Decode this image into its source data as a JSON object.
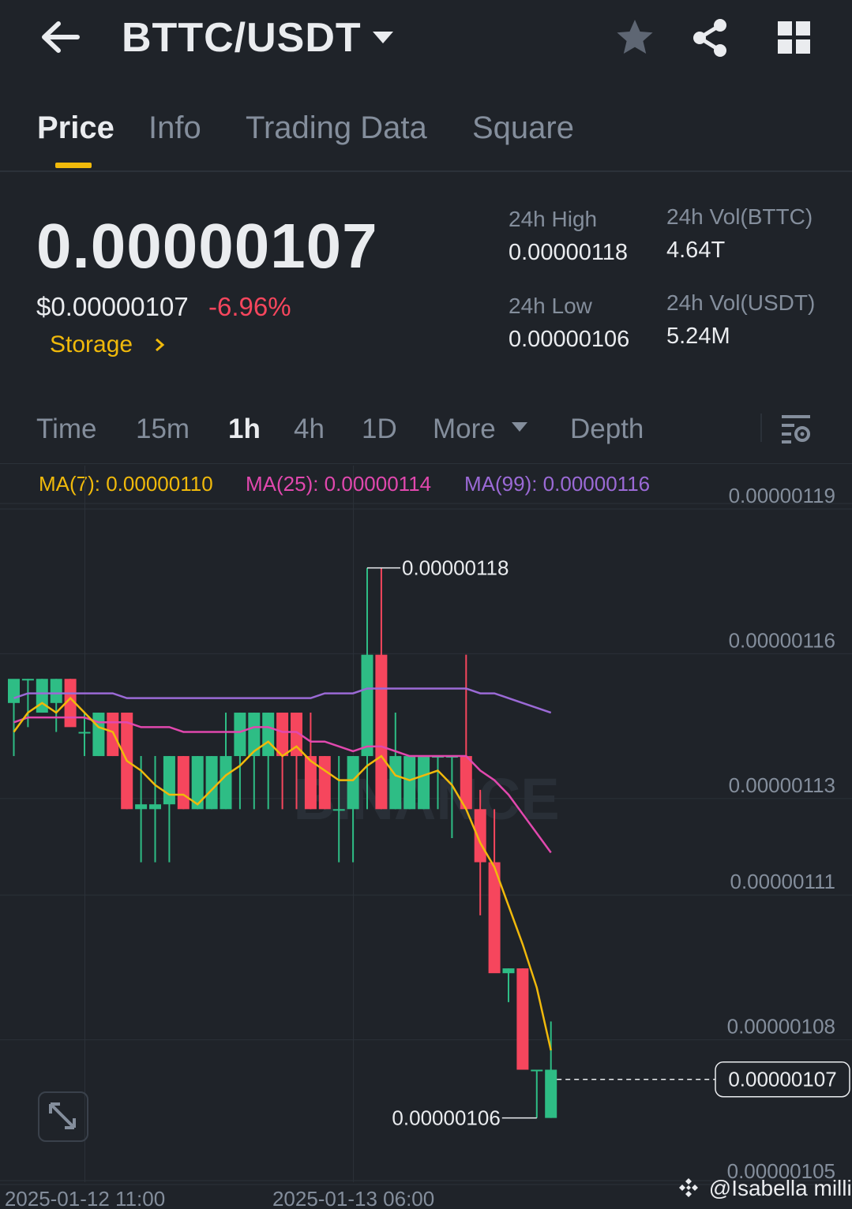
{
  "header": {
    "pair": "BTTC/USDT",
    "back_icon": "arrow-left-icon",
    "icons": [
      "star-icon",
      "share-icon",
      "grid-icon"
    ]
  },
  "tabs": [
    {
      "label": "Price",
      "active": true
    },
    {
      "label": "Info",
      "active": false
    },
    {
      "label": "Trading Data",
      "active": false
    },
    {
      "label": "Square",
      "active": false
    }
  ],
  "ticker": {
    "last_price": "0.00000107",
    "usd_price": "$0.00000107",
    "change": "-6.96%",
    "tag": "Storage",
    "stats": [
      {
        "label": "24h High",
        "value": "0.00000118"
      },
      {
        "label": "24h Vol(BTTC)",
        "value": "4.64T"
      },
      {
        "label": "24h Low",
        "value": "0.00000106"
      },
      {
        "label": "24h Vol(USDT)",
        "value": "5.24M"
      }
    ]
  },
  "intervals": [
    {
      "label": "Time",
      "active": false
    },
    {
      "label": "15m",
      "active": false
    },
    {
      "label": "1h",
      "active": true
    },
    {
      "label": "4h",
      "active": false
    },
    {
      "label": "1D",
      "active": false
    },
    {
      "label": "More",
      "active": false
    },
    {
      "label": "Depth",
      "active": false
    }
  ],
  "ma_legend": [
    {
      "label": "MA(7): 0.00000110",
      "color": "#f0b90b"
    },
    {
      "label": "MA(25): 0.00000114",
      "color": "#e148ae"
    },
    {
      "label": "MA(99): 0.00000116",
      "color": "#9b6ad6"
    }
  ],
  "colors": {
    "up": "#2ebd85",
    "down": "#f6465d",
    "accent": "#f0b90b"
  },
  "chart_data": {
    "type": "candlestick",
    "y_ticks": [
      "0.00000119",
      "0.00000116",
      "0.00000113",
      "0.00000111",
      "0.00000108",
      "0.00000105"
    ],
    "y_tick_values": [
      119.0,
      116.0,
      113.0,
      111.0,
      108.0,
      105.0
    ],
    "ylim": [
      105.0,
      119.0
    ],
    "x_ticks": [
      "2025-01-12 11:00",
      "2025-01-13 06:00"
    ],
    "x_tick_index": [
      5,
      24
    ],
    "high_label": "0.00000118",
    "low_label": "0.00000106",
    "last_label": "0.00000107",
    "last_value": 107.0,
    "value_unit": "1e-8 USDT",
    "candles": [
      {
        "o": 114.8,
        "h": 115.2,
        "l": 113.7,
        "c": 115.3
      },
      {
        "o": 115.3,
        "h": 115.3,
        "l": 114.3,
        "c": 115.3
      },
      {
        "o": 114.6,
        "h": 115.3,
        "l": 114.6,
        "c": 115.3
      },
      {
        "o": 114.8,
        "h": 115.3,
        "l": 114.2,
        "c": 115.3
      },
      {
        "o": 115.3,
        "h": 115.3,
        "l": 114.6,
        "c": 114.3
      },
      {
        "o": 114.2,
        "h": 114.6,
        "l": 113.7,
        "c": 114.2
      },
      {
        "o": 113.7,
        "h": 114.6,
        "l": 113.7,
        "c": 114.6
      },
      {
        "o": 114.6,
        "h": 114.6,
        "l": 113.7,
        "c": 113.7
      },
      {
        "o": 114.6,
        "h": 114.6,
        "l": 112.6,
        "c": 112.6
      },
      {
        "o": 112.6,
        "h": 113.7,
        "l": 111.5,
        "c": 112.7
      },
      {
        "o": 112.6,
        "h": 113.7,
        "l": 111.5,
        "c": 112.7
      },
      {
        "o": 112.7,
        "h": 113.7,
        "l": 111.5,
        "c": 113.7
      },
      {
        "o": 113.7,
        "h": 113.7,
        "l": 112.6,
        "c": 112.6
      },
      {
        "o": 112.6,
        "h": 113.7,
        "l": 112.6,
        "c": 113.7
      },
      {
        "o": 112.6,
        "h": 113.7,
        "l": 112.6,
        "c": 113.7
      },
      {
        "o": 112.6,
        "h": 114.6,
        "l": 112.6,
        "c": 113.7
      },
      {
        "o": 113.7,
        "h": 114.6,
        "l": 112.6,
        "c": 114.6
      },
      {
        "o": 113.7,
        "h": 114.6,
        "l": 112.6,
        "c": 114.6
      },
      {
        "o": 113.7,
        "h": 114.6,
        "l": 112.6,
        "c": 114.6
      },
      {
        "o": 114.6,
        "h": 114.6,
        "l": 112.6,
        "c": 113.7
      },
      {
        "o": 114.6,
        "h": 114.6,
        "l": 112.6,
        "c": 113.7
      },
      {
        "o": 113.7,
        "h": 114.6,
        "l": 112.6,
        "c": 112.6
      },
      {
        "o": 113.7,
        "h": 113.7,
        "l": 112.6,
        "c": 112.6
      },
      {
        "o": 112.6,
        "h": 113.7,
        "l": 111.5,
        "c": 112.6
      },
      {
        "o": 112.6,
        "h": 113.7,
        "l": 111.5,
        "c": 113.7
      },
      {
        "o": 113.7,
        "h": 117.6,
        "l": 112.6,
        "c": 115.8
      },
      {
        "o": 115.8,
        "h": 117.6,
        "l": 112.6,
        "c": 112.6
      },
      {
        "o": 112.6,
        "h": 114.6,
        "l": 112.6,
        "c": 113.7
      },
      {
        "o": 112.6,
        "h": 113.7,
        "l": 112.6,
        "c": 113.7
      },
      {
        "o": 112.6,
        "h": 113.7,
        "l": 112.6,
        "c": 113.7
      },
      {
        "o": 113.7,
        "h": 113.7,
        "l": 112.6,
        "c": 113.7
      },
      {
        "o": 113.7,
        "h": 113.7,
        "l": 112.0,
        "c": 113.7
      },
      {
        "o": 113.7,
        "h": 115.8,
        "l": 112.6,
        "c": 112.6
      },
      {
        "o": 112.6,
        "h": 113.0,
        "l": 110.4,
        "c": 111.5
      },
      {
        "o": 111.5,
        "h": 112.6,
        "l": 109.3,
        "c": 109.2
      },
      {
        "o": 109.2,
        "h": 109.3,
        "l": 108.6,
        "c": 109.3
      },
      {
        "o": 109.3,
        "h": 109.3,
        "l": 107.9,
        "c": 107.2
      },
      {
        "o": 107.2,
        "h": 107.2,
        "l": 106.2,
        "c": 107.2
      },
      {
        "o": 106.2,
        "h": 108.2,
        "l": 106.2,
        "c": 107.2
      }
    ],
    "ma7": [
      114.2,
      114.6,
      114.8,
      114.6,
      114.9,
      114.6,
      114.3,
      114.2,
      113.6,
      113.4,
      113.1,
      112.9,
      112.9,
      112.7,
      113.0,
      113.3,
      113.5,
      113.8,
      114.0,
      113.7,
      113.9,
      113.6,
      113.4,
      113.2,
      113.2,
      113.5,
      113.7,
      113.3,
      113.2,
      113.3,
      113.4,
      113.1,
      112.6,
      111.9,
      111.4,
      110.6,
      109.8,
      108.9,
      107.6
    ],
    "ma25": [
      114.4,
      114.5,
      114.5,
      114.5,
      114.5,
      114.5,
      114.4,
      114.4,
      114.4,
      114.3,
      114.3,
      114.3,
      114.2,
      114.2,
      114.2,
      114.2,
      114.2,
      114.3,
      114.3,
      114.2,
      114.2,
      114.0,
      114.0,
      113.9,
      113.8,
      113.9,
      113.9,
      113.8,
      113.7,
      113.7,
      113.7,
      113.7,
      113.7,
      113.4,
      113.2,
      112.9,
      112.5,
      112.1,
      111.7
    ],
    "ma99": [
      114.9,
      115.0,
      115.0,
      115.0,
      115.0,
      115.0,
      115.0,
      115.0,
      114.9,
      114.9,
      114.9,
      114.9,
      114.9,
      114.9,
      114.9,
      114.9,
      114.9,
      114.9,
      114.9,
      114.9,
      114.9,
      114.9,
      115.0,
      115.0,
      115.0,
      115.1,
      115.1,
      115.1,
      115.1,
      115.1,
      115.1,
      115.1,
      115.1,
      115.0,
      115.0,
      114.9,
      114.8,
      114.7,
      114.6
    ]
  },
  "watermark": "@Isabella millie"
}
